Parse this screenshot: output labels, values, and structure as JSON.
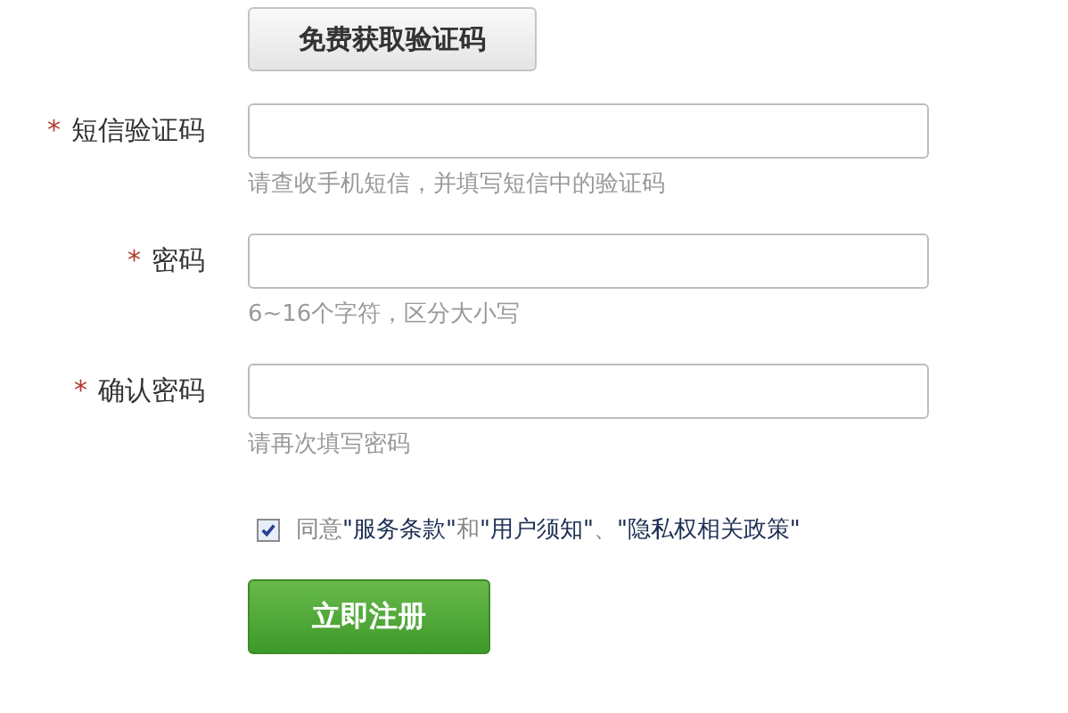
{
  "code_button": "免费获取验证码",
  "fields": [
    {
      "label": "短信验证码",
      "required": true,
      "hint": "请查收手机短信，并填写短信中的验证码"
    },
    {
      "label": "密码",
      "required": true,
      "hint": "6~16个字符，区分大小写"
    },
    {
      "label": "确认密码",
      "required": true,
      "hint": "请再次填写密码"
    }
  ],
  "required_mark": "*",
  "agreement": {
    "checked": true,
    "parts": [
      {
        "kind": "plain",
        "text": "同意"
      },
      {
        "kind": "link",
        "text": "\"服务条款\""
      },
      {
        "kind": "plain",
        "text": "和"
      },
      {
        "kind": "link",
        "text": "\"用户须知\""
      },
      {
        "kind": "plain",
        "text": "、"
      },
      {
        "kind": "link",
        "text": "\"隐私权相关政策\""
      }
    ]
  },
  "submit_button": "立即注册"
}
